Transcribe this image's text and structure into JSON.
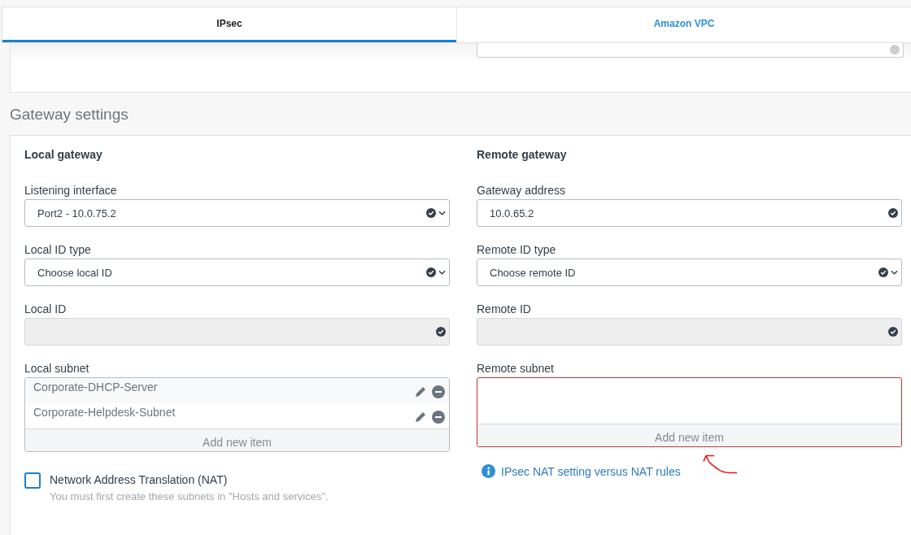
{
  "tabs": [
    {
      "label": "IPsec",
      "selected": true
    },
    {
      "label": "Amazon VPC",
      "selected": false
    }
  ],
  "section_title": "Gateway settings",
  "columns": [
    {
      "title": "Local gateway",
      "fields": [
        {
          "kind": "select",
          "label": "Listening interface",
          "value": "Port2 - 10.0.75.2"
        },
        {
          "kind": "select",
          "label": "Local ID type",
          "value": "Choose local ID"
        },
        {
          "kind": "readonly",
          "label": "Local ID"
        },
        {
          "kind": "list",
          "label": "Local subnet",
          "error": false,
          "items": [
            "Corporate-DHCP-Server",
            "Corporate-Helpdesk-Subnet"
          ],
          "add_label": "Add new item"
        }
      ]
    },
    {
      "title": "Remote gateway",
      "fields": [
        {
          "kind": "text",
          "label": "Gateway address",
          "value": "10.0.65.2"
        },
        {
          "kind": "select",
          "label": "Remote ID type",
          "value": "Choose remote ID"
        },
        {
          "kind": "readonly",
          "label": "Remote ID"
        },
        {
          "kind": "list",
          "label": "Remote subnet",
          "error": true,
          "add_label": "Add new item"
        }
      ]
    }
  ],
  "nat": {
    "label": "Network Address Translation (NAT)",
    "checked": false,
    "hint": "You must first create these subnets in \"Hosts and services\"."
  },
  "info_link": "IPsec NAT setting versus NAT rules"
}
